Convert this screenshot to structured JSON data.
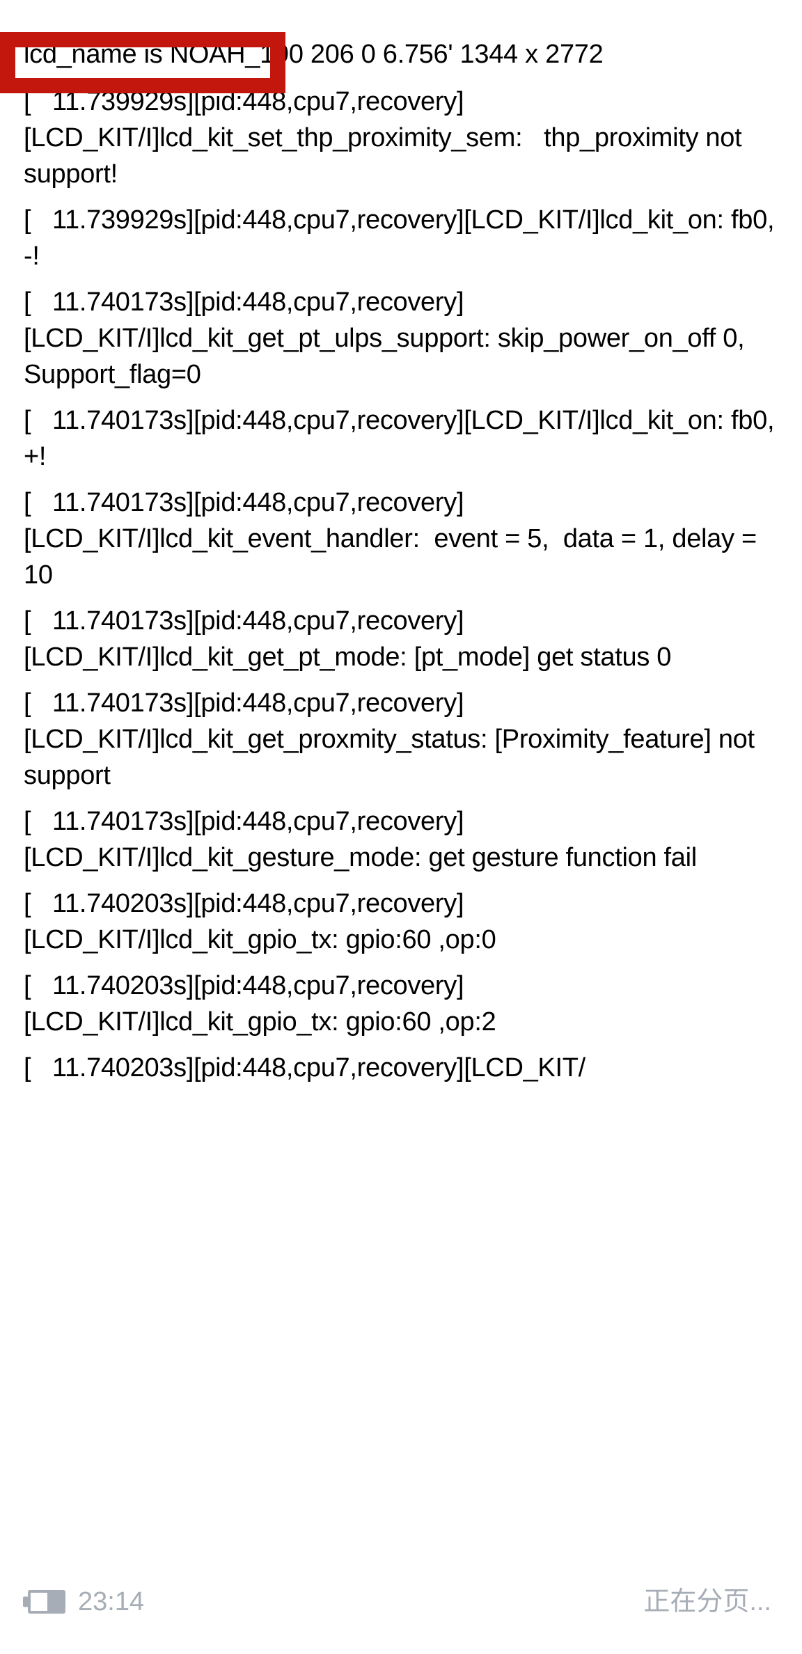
{
  "screen": {
    "background_color": "#ffffff",
    "text_color": "#000000",
    "highlight_color": "#c3170d",
    "status_color": "#a7adb6"
  },
  "log": {
    "first_line": "lcd_name is NOAH_190 206 0 6.756' 1344 x 2772",
    "entries": [
      "[   11.739929s][pid:448,cpu7,recovery][LCD_KIT/I]lcd_kit_set_thp_proximity_sem:   thp_proximity not support!",
      "[   11.739929s][pid:448,cpu7,recovery][LCD_KIT/I]lcd_kit_on: fb0, -!",
      "[   11.740173s][pid:448,cpu7,recovery][LCD_KIT/I]lcd_kit_get_pt_ulps_support: skip_power_on_off 0, Support_flag=0",
      "[   11.740173s][pid:448,cpu7,recovery][LCD_KIT/I]lcd_kit_on: fb0, +!",
      "[   11.740173s][pid:448,cpu7,recovery][LCD_KIT/I]lcd_kit_event_handler:  event = 5,  data = 1, delay = 10",
      "[   11.740173s][pid:448,cpu7,recovery][LCD_KIT/I]lcd_kit_get_pt_mode: [pt_mode] get status 0",
      "[   11.740173s][pid:448,cpu7,recovery][LCD_KIT/I]lcd_kit_get_proxmity_status: [Proximity_feature] not support",
      "[   11.740173s][pid:448,cpu7,recovery][LCD_KIT/I]lcd_kit_gesture_mode: get gesture function fail",
      "[   11.740203s][pid:448,cpu7,recovery][LCD_KIT/I]lcd_kit_gpio_tx: gpio:60 ,op:0",
      "[   11.740203s][pid:448,cpu7,recovery][LCD_KIT/I]lcd_kit_gpio_tx: gpio:60 ,op:2",
      "[   11.740203s][pid:448,cpu7,recovery][LCD_KIT/"
    ]
  },
  "status_bar": {
    "battery_icon": "battery-icon",
    "battery_level_percent": 47,
    "clock": "23:14",
    "paging_status": "正在分页..."
  }
}
